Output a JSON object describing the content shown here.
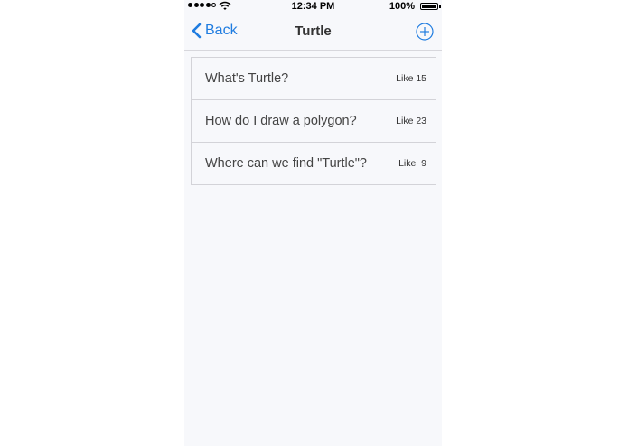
{
  "status_bar": {
    "time": "12:34 PM",
    "battery_percent": "100%",
    "battery_level": 1.0,
    "signal_bars_filled": 4,
    "signal_bars_total": 5
  },
  "nav": {
    "back_label": "Back",
    "title": "Turtle",
    "back_icon": "chevron-left-icon",
    "add_icon": "plus-circle-icon"
  },
  "colors": {
    "accent": "#1f7ce0",
    "background": "#f7f8fb",
    "separator": "#d3d3d8"
  },
  "questions": [
    {
      "title": "What's Turtle?",
      "likes": "Like 15"
    },
    {
      "title": "How do I draw a polygon?",
      "likes": "Like 23"
    },
    {
      "title": "Where can we find \"Turtle\"?",
      "likes": "Like  9"
    }
  ]
}
